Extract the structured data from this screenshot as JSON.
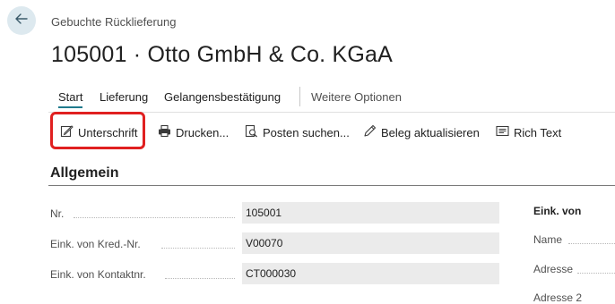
{
  "header": {
    "caption": "Gebuchte Rücklieferung",
    "title": "105001 · Otto GmbH & Co. KGaA"
  },
  "tabs": [
    {
      "label": "Start",
      "active": true
    },
    {
      "label": "Lieferung"
    },
    {
      "label": "Gelangensbestätigung"
    },
    {
      "label": "Weitere Optionen"
    }
  ],
  "actions": [
    {
      "label": "Unterschrift",
      "icon": "signature-icon",
      "highlighted": true
    },
    {
      "label": "Drucken...",
      "icon": "printer-icon"
    },
    {
      "label": "Posten suchen...",
      "icon": "find-entries-icon"
    },
    {
      "label": "Beleg aktualisieren",
      "icon": "pencil-icon"
    },
    {
      "label": "Rich Text",
      "icon": "rich-text-icon"
    }
  ],
  "section": {
    "title": "Allgemein",
    "fields": [
      {
        "label": "Nr.",
        "value": "105001"
      },
      {
        "label": "Eink. von Kred.-Nr.",
        "value": "V00070"
      },
      {
        "label": "Eink. von Kontaktnr.",
        "value": "CT000030"
      }
    ],
    "right_group": {
      "title": "Eink. von",
      "fields": [
        {
          "label": "Name"
        },
        {
          "label": "Adresse"
        },
        {
          "label": "Adresse 2"
        }
      ]
    }
  },
  "colors": {
    "accent": "#1f7a8c",
    "highlight": "#e02020",
    "field_background": "#ebebeb"
  }
}
